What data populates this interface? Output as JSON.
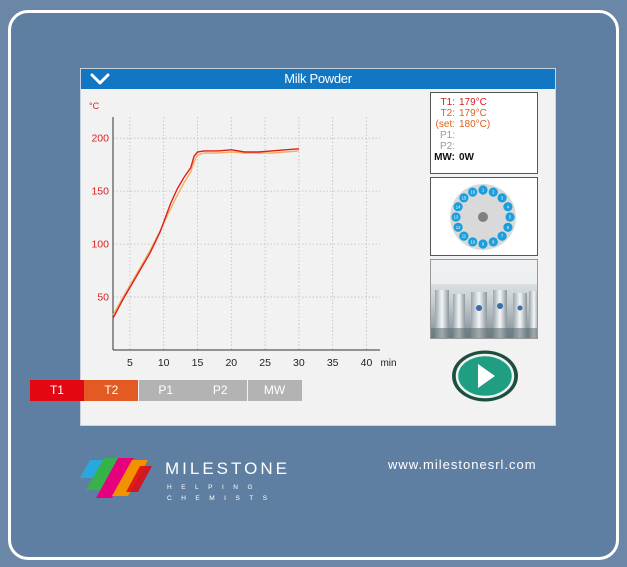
{
  "screen": {
    "title": "Milk Powder"
  },
  "chart_data": {
    "type": "line",
    "ylabel": "°C",
    "xlabel": "min",
    "xlim": [
      2.5,
      42
    ],
    "ylim": [
      0,
      220
    ],
    "x_ticks": [
      5,
      10,
      15,
      20,
      25,
      30,
      35,
      40
    ],
    "y_ticks": [
      50,
      100,
      150,
      200
    ],
    "grid": true,
    "series": [
      {
        "name": "T1",
        "color": "#e0201c",
        "x": [
          2.5,
          4,
          6,
          8,
          9.5,
          11,
          12,
          13,
          14,
          14.5,
          15,
          16,
          18,
          20,
          22,
          24,
          26,
          28,
          30
        ],
        "y": [
          30,
          48,
          70,
          92,
          112,
          138,
          152,
          163,
          172,
          183,
          187,
          188,
          188,
          189,
          187,
          187,
          188,
          189,
          190
        ]
      },
      {
        "name": "T2",
        "color": "#f0b060",
        "x": [
          2.5,
          4,
          6,
          8,
          9.5,
          11,
          12,
          13,
          14,
          14.5,
          15,
          16,
          18,
          20,
          22,
          24,
          26,
          28,
          30
        ],
        "y": [
          33,
          50,
          72,
          94,
          113,
          133,
          146,
          158,
          168,
          178,
          184,
          186,
          186,
          187,
          186,
          186,
          186,
          187,
          188
        ]
      }
    ]
  },
  "legend": [
    {
      "label": "T1",
      "color": "#e30613"
    },
    {
      "label": "T2",
      "color": "#e35b22"
    },
    {
      "label": "P1",
      "color": "#b3b3b3"
    },
    {
      "label": "P2",
      "color": "#b3b3b3"
    },
    {
      "label": "MW",
      "color": "#b3b3b3"
    }
  ],
  "readout": {
    "t1_key": "T1:",
    "t1_val": "179°C",
    "t2_key": "T2:",
    "t2_val": "179°C",
    "set_key": "(set:",
    "set_val": "180°C)",
    "p1_key": "P1:",
    "p1_val": "",
    "p2_key": "P2:",
    "p2_val": "",
    "mw_key": "MW:",
    "mw_val": "0W",
    "colors": {
      "t1": "#d92020",
      "t2": "#e0601e",
      "set": "#e0601e",
      "dim": "#999999",
      "mw": "#111111"
    }
  },
  "carousel": {
    "positions": 16,
    "labels": [
      "1",
      "2",
      "3",
      "4",
      "5",
      "6",
      "7",
      "8",
      "9",
      "10",
      "11",
      "12",
      "13",
      "14",
      "15",
      "16"
    ],
    "vessel_color": "#1a9fdc"
  },
  "brand": {
    "name": "MILESTONE",
    "tagline_1": "HELPING",
    "tagline_2": "CHEMISTS",
    "url": "www.milestonesrl.com"
  },
  "icons": {
    "collapse": "chevron-down-icon",
    "start": "play-icon"
  }
}
